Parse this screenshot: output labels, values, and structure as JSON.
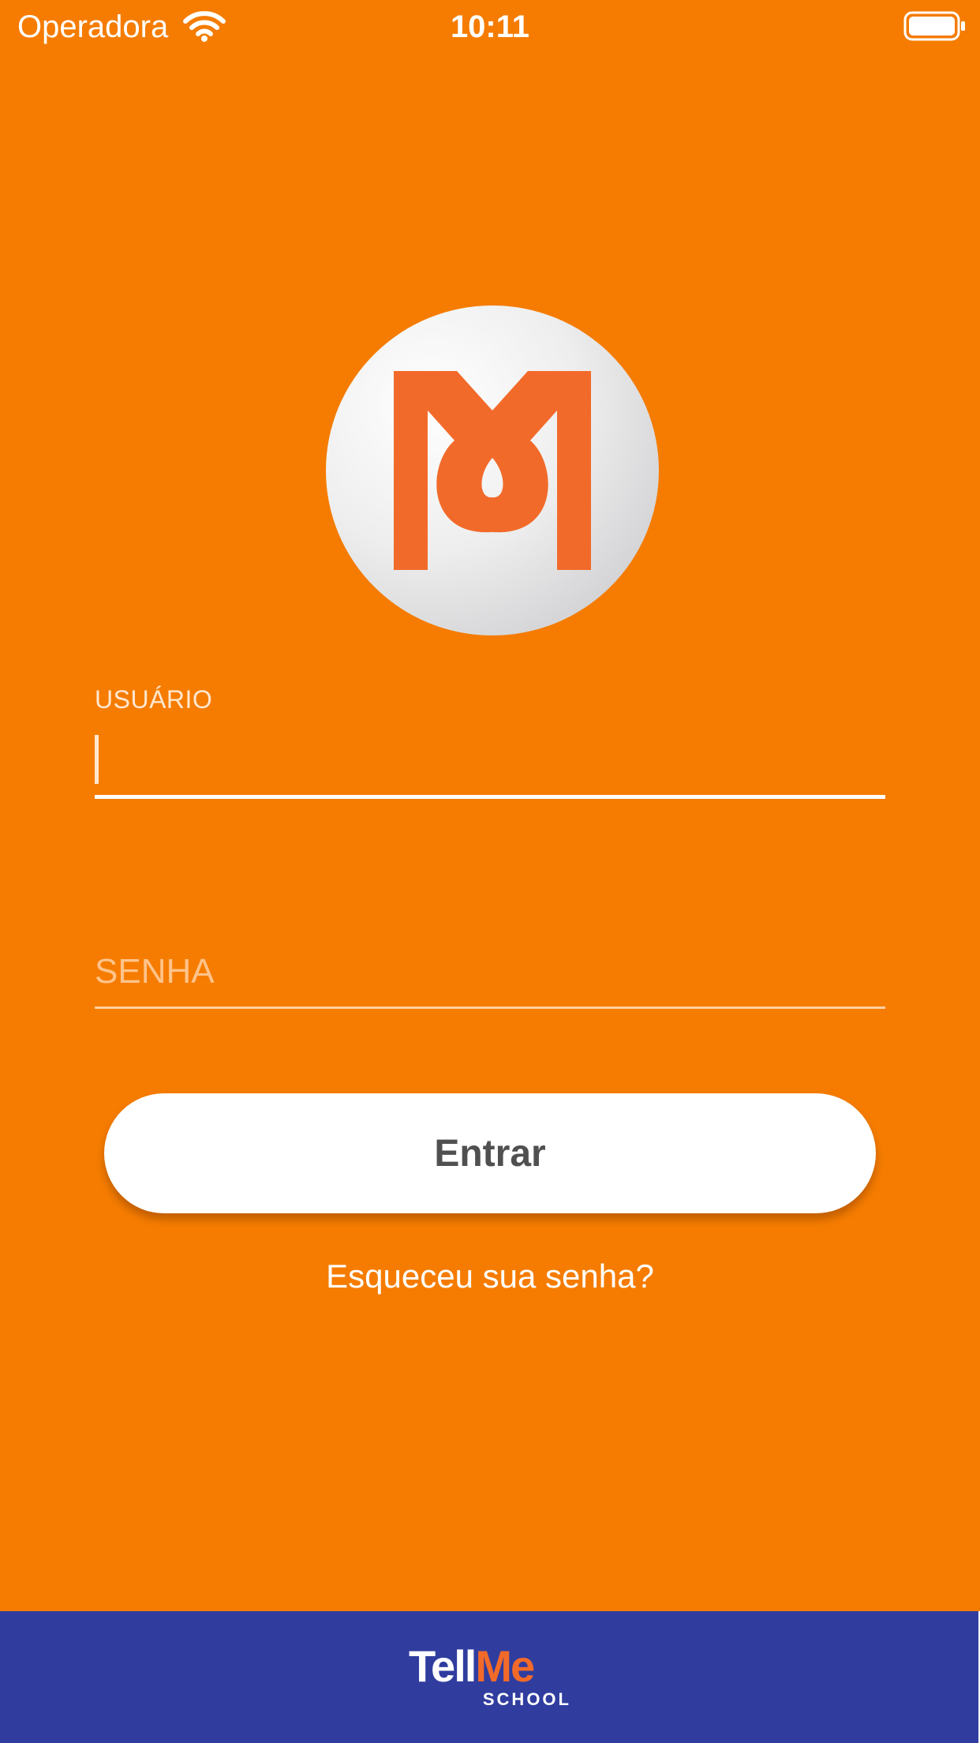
{
  "status_bar": {
    "carrier": "Operadora",
    "time": "10:11",
    "wifi_icon": "wifi-icon",
    "battery_icon": "battery-full-icon"
  },
  "logo": {
    "icon": "tellme-m-logo-icon",
    "mark_color": "#F26A2A"
  },
  "form": {
    "user_label": "USUÁRIO",
    "user_value": "",
    "password_placeholder": "SENHA",
    "password_value": ""
  },
  "actions": {
    "enter_label": "Entrar",
    "forgot_label": "Esqueceu sua senha?"
  },
  "footer": {
    "brand_part_1": "Tell",
    "brand_part_2": "Me",
    "brand_sub": "SCHOOL"
  },
  "colors": {
    "background": "#F57C00",
    "footer": "#303D9F",
    "accent": "#F26A2A",
    "button": "#FFFFFF",
    "button_text": "#505050"
  }
}
